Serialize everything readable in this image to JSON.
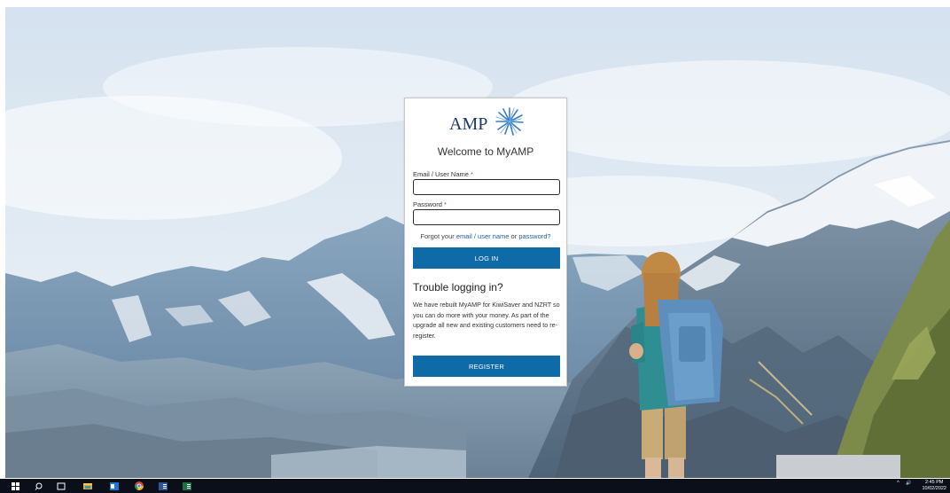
{
  "login_card": {
    "logo_text": "AMP",
    "welcome": "Welcome to MyAMP",
    "email_label": "Email / User Name",
    "email_value": "",
    "password_label": "Password",
    "password_value": "",
    "required_marker": "*",
    "forgot_prefix": "Forgot your",
    "forgot_link_email": "email / user name",
    "forgot_or": "or",
    "forgot_link_password": "password?",
    "login_button": "LOG IN",
    "trouble_title": "Trouble logging in?",
    "trouble_text": "We have rebuilt MyAMP for KiwiSaver and NZRT so you can do more with your money. As part of the upgrade all new and existing customers need to re-register.",
    "register_button": "REGISTER"
  },
  "taskbar": {
    "icons": [
      "windows-start-icon",
      "search-icon",
      "task-view-icon",
      "file-explorer-icon",
      "outlook-icon",
      "chrome-icon",
      "word-icon",
      "excel-icon"
    ],
    "tray_chevron": "^",
    "tray_volume": "🔊",
    "time": "2:45 PM",
    "date": "10/02/2022"
  },
  "colors": {
    "brand_blue": "#0f6aa8",
    "logo_navy": "#1c3a6a",
    "link": "#1f5fa6",
    "taskbar": "#0b0f1a"
  }
}
